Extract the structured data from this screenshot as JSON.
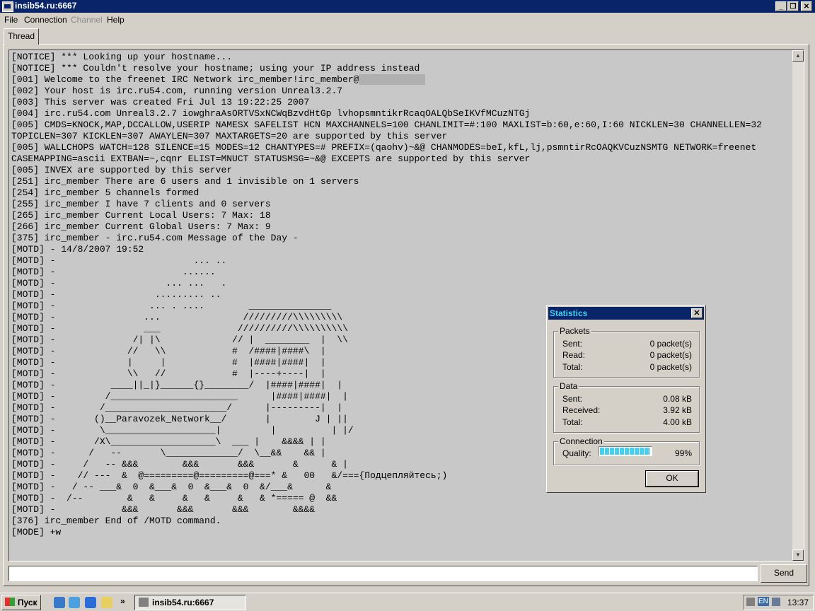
{
  "window": {
    "title": "insib54.ru:6667",
    "min": "_",
    "max": "❐",
    "close": "✕"
  },
  "menu": [
    "File",
    "Connection",
    "Channel",
    "Help"
  ],
  "tabs": [
    "Thread"
  ],
  "log_lines": [
    "[NOTICE] *** Looking up your hostname...",
    "[NOTICE] *** Couldn't resolve your hostname; using your IP address instead",
    "[001] Welcome to the freenet IRC Network irc_member!irc_member@",
    "[002] Your host is irc.ru54.com, running version Unreal3.2.7",
    "[003] This server was created Fri Jul 13 19:22:25 2007",
    "[004] irc.ru54.com Unreal3.2.7 iowghraAsORTVSxNCWqBzvdHtGp lvhopsmntikrRcaqOALQbSeIKVfMCuzNTGj",
    "[005] CMDS=KNOCK,MAP,DCCALLOW,USERIP NAMESX SAFELIST HCN MAXCHANNELS=100 CHANLIMIT=#:100 MAXLIST=b:60,e:60,I:60 NICKLEN=30 CHANNELLEN=32",
    "TOPICLEN=307 KICKLEN=307 AWAYLEN=307 MAXTARGETS=20 are supported by this server",
    "[005] WALLCHOPS WATCH=128 SILENCE=15 MODES=12 CHANTYPES=# PREFIX=(qaohv)~&@ CHANMODES=beI,kfL,lj,psmntirRcOAQKVCuzNSMTG NETWORK=freenet",
    "CASEMAPPING=ascii EXTBAN=~,cqnr ELIST=MNUCT STATUSMSG=~&@ EXCEPTS are supported by this server",
    "[005] INVEX are supported by this server",
    "[251] irc_member There are 6 users and 1 invisible on 1 servers",
    "[254] irc_member 5 channels formed",
    "[255] irc_member I have 7 clients and 0 servers",
    "[265] irc_member Current Local Users: 7 Max: 18",
    "[266] irc_member Current Global Users: 7 Max: 9",
    "[375] irc_member - irc.ru54.com Message of the Day -",
    "[MOTD] - 14/8/2007 19:52",
    "[MOTD] -                         ... ..",
    "[MOTD] -                       ......",
    "[MOTD] -                    ... ...   .",
    "[MOTD] -                  ......... ..",
    "[MOTD] -                 ... . ....        _______________",
    "[MOTD] -                ...               /////////\\\\\\\\\\\\\\\\\\",
    "[MOTD] -                ___              //////////\\\\\\\\\\\\\\\\\\\\",
    "[MOTD] -              /| |\\             // |  ________  |  \\\\",
    "[MOTD] -             //   \\\\            #  /####|####\\  |",
    "[MOTD] -             |     |            #  |####|####|  |",
    "[MOTD] -             \\\\   //            #  |----+----|  |",
    "[MOTD] -          ____||_|}______{}________/  |####|####|  |",
    "[MOTD] -         /_______________________      |####|####|  |",
    "[MOTD] -        /______________________/      |---------|  |",
    "[MOTD] -       ()__Paravozek_Network__/       |        J | ||",
    "[MOTD] -        \\____________________|         |          | |/",
    "[MOTD] -       /X\\___________________\\  ___ |    &&&& | |",
    "[MOTD] -      /   --       \\_____________/  \\__&&    && |",
    "[MOTD] -     /   -- &&&        &&&       &&&       &      & |",
    "[MOTD] -    // ---  &  @=========@=========@===* &   00   &/==={Подцепляйтесь;)",
    "[MOTD] -   / -- ___&  0  &___&  0  &___&  0  &/___&      &",
    "[MOTD] -  /--        &   &     &   &     &   & *===== @  &&",
    "[MOTD] -            &&&       &&&       &&&        &&&&",
    "[376] irc_member End of /MOTD command.",
    "[MODE] +w"
  ],
  "input": {
    "value": "",
    "send_label": "Send"
  },
  "statistics": {
    "title": "Statistics",
    "close": "✕",
    "packets": {
      "label": "Packets",
      "sent_k": "Sent:",
      "sent_v": "0 packet(s)",
      "read_k": "Read:",
      "read_v": "0 packet(s)",
      "total_k": "Total:",
      "total_v": "0 packet(s)"
    },
    "data": {
      "label": "Data",
      "sent_k": "Sent:",
      "sent_v": "0.08 kB",
      "recv_k": "Received:",
      "recv_v": "3.92 kB",
      "total_k": "Total:",
      "total_v": "4.00 kB"
    },
    "connection": {
      "label": "Connection",
      "quality_k": "Quality:",
      "quality_v": "99%",
      "quality_fraction": 0.99
    },
    "ok_label": "OK",
    "accent_color": "#46d0f0"
  },
  "taskbar": {
    "start_label": "Пуск",
    "task_label": "insib54.ru:6667",
    "lang": "EN",
    "clock": "13:37",
    "chevron": "»"
  }
}
